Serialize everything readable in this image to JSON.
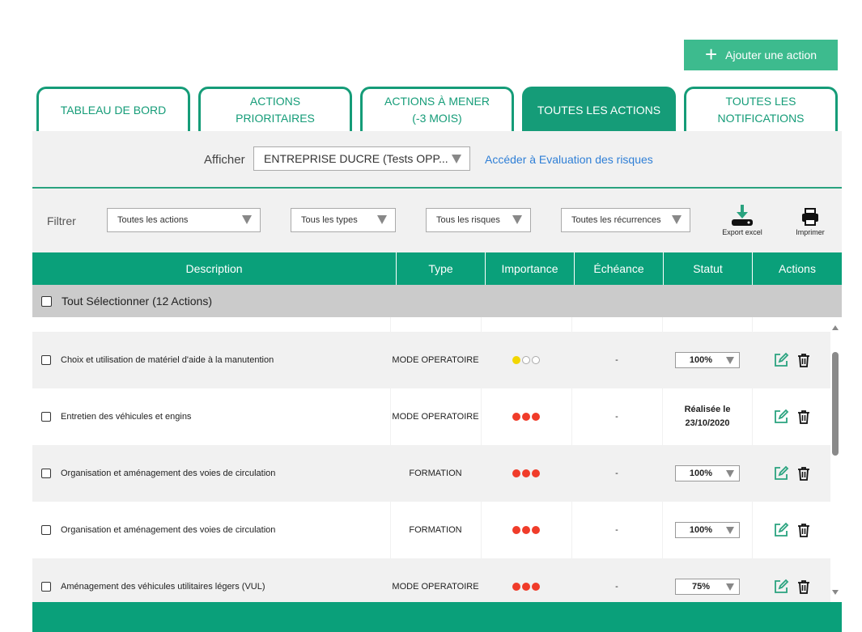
{
  "add_button": {
    "label": "Ajouter une action"
  },
  "tabs": [
    {
      "label": "TABLEAU DE BORD",
      "active": false
    },
    {
      "label": "ACTIONS\nPRIORITAIRES",
      "active": false
    },
    {
      "label": "ACTIONS À MENER\n(-3 MOIS)",
      "active": false
    },
    {
      "label": "TOUTES LES ACTIONS",
      "active": true
    },
    {
      "label": "TOUTES LES\nNOTIFICATIONS",
      "active": false
    }
  ],
  "display": {
    "label": "Afficher",
    "selected": "ENTREPRISE DUCRE (Tests OPP...",
    "link": "Accéder à Evaluation des risques"
  },
  "filters": {
    "label": "Filtrer",
    "actions": "Toutes les actions",
    "types": "Tous les types",
    "risks": "Tous les risques",
    "recurrences": "Toutes les récurrences",
    "export_label": "Export excel",
    "print_label": "Imprimer"
  },
  "table": {
    "headers": [
      "Description",
      "Type",
      "Importance",
      "Échéance",
      "Statut",
      "Actions"
    ],
    "select_all": "Tout Sélectionner (12 Actions)",
    "rows": [
      {
        "description": "Choix et utilisation de matériel d'aide à la manutention",
        "type": "MODE OPERATOIRE",
        "importance": 1,
        "deadline": "-",
        "status": "100%",
        "done_line1": "",
        "done_line2": ""
      },
      {
        "description": "Entretien des véhicules et engins",
        "type": "MODE OPERATOIRE",
        "importance": 3,
        "deadline": "-",
        "status": "",
        "done_line1": "Réalisée le",
        "done_line2": "23/10/2020"
      },
      {
        "description": "Organisation et aménagement des voies de circulation",
        "type": "FORMATION",
        "importance": 3,
        "deadline": "-",
        "status": "100%",
        "done_line1": "",
        "done_line2": ""
      },
      {
        "description": "Organisation et aménagement des voies de circulation",
        "type": "FORMATION",
        "importance": 3,
        "deadline": "-",
        "status": "100%",
        "done_line1": "",
        "done_line2": ""
      },
      {
        "description": "Aménagement des véhicules utilitaires légers (VUL)",
        "type": "MODE OPERATOIRE",
        "importance": 3,
        "deadline": "-",
        "status": "75%",
        "done_line1": "",
        "done_line2": ""
      }
    ]
  },
  "colors": {
    "accent": "#0aa07a",
    "button": "#3dbb8e",
    "link": "#2f7fd6",
    "dot_yellow": "#f2d600",
    "dot_red": "#f03c2a"
  },
  "icons": {
    "add": "plus-icon",
    "export": "download-icon",
    "print": "printer-icon",
    "edit": "edit-icon",
    "delete": "trash-icon"
  }
}
